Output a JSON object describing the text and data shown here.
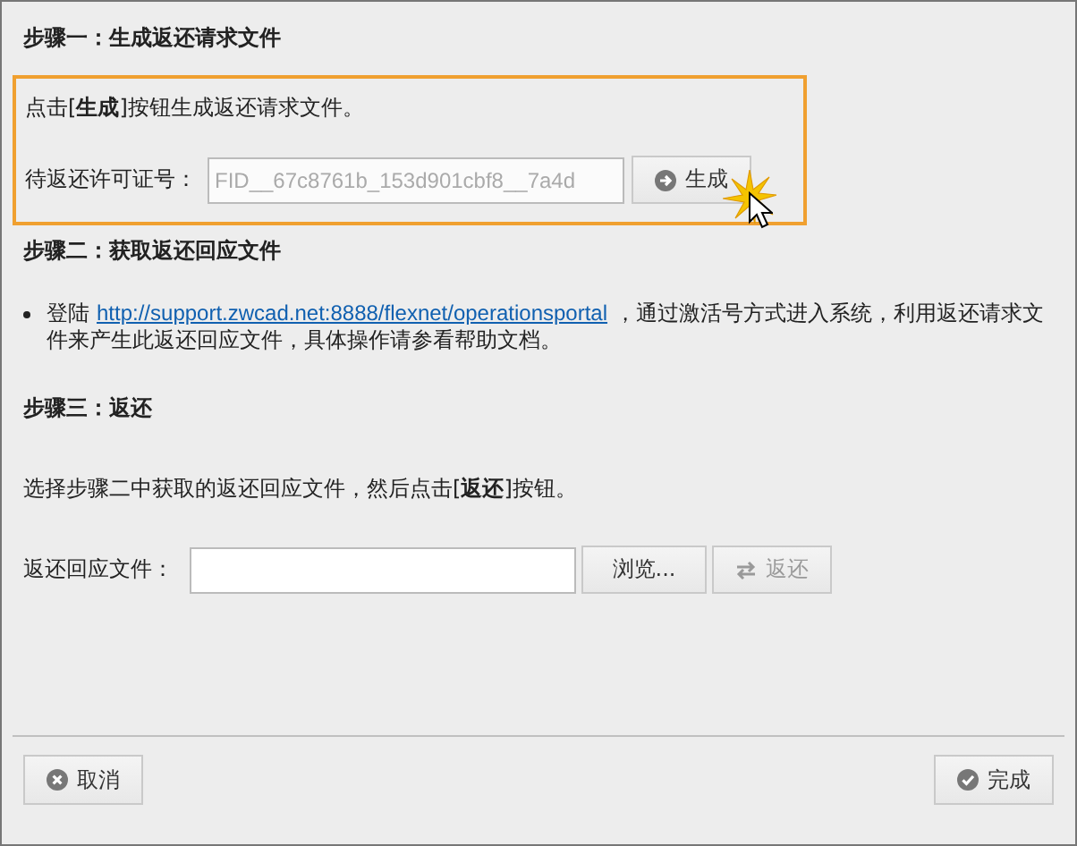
{
  "step1": {
    "title": "步骤一：生成返还请求文件",
    "instruction": "点击[**生成**]按钮生成返还请求文件。",
    "field_label": "待返还许可证号：",
    "field": {
      "value": "FID__67c8761b_153d901cbf8__7a4d",
      "disabled": true
    },
    "button": {
      "label": "生成",
      "disabled": false
    }
  },
  "step2": {
    "title": "步骤二：获取返还回应文件",
    "text_before": "登陆",
    "link": "http://support.zwcad.net:8888/flexnet/operationsportal",
    "text_after": "，通过激活号方式进入系统，利用返还请求文件来产生此返还回应文件，具体操作请参看帮助文档。"
  },
  "step3": {
    "title": "步骤三：返还",
    "instruction": "选择步骤二中获取的返还回应文件，然后点击[**返还**]按钮。",
    "field_label": "返还回应文件：",
    "browse_button": {
      "label": "浏览...",
      "disabled": false
    },
    "return_button": {
      "label": "返还",
      "disabled": true
    }
  },
  "footer": {
    "cancel_button": {
      "label": "取消",
      "disabled": false
    },
    "finish_button": {
      "label": "完成",
      "disabled": false
    }
  }
}
